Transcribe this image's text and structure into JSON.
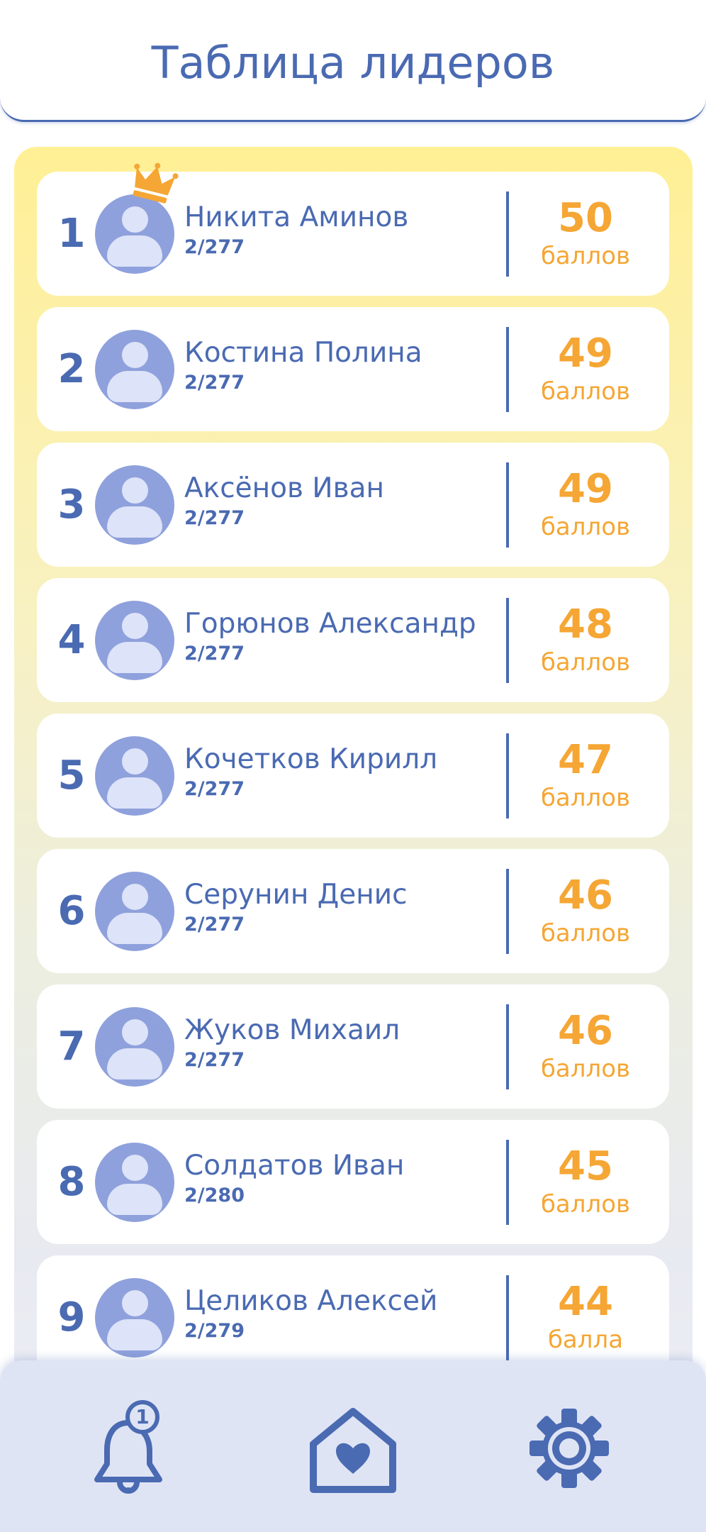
{
  "header": {
    "title": "Таблица лидеров"
  },
  "leaders": [
    {
      "rank": "1",
      "name": "Никита Аминов",
      "sub": "2/277",
      "score": "50",
      "unit": "баллов"
    },
    {
      "rank": "2",
      "name": "Костина Полина",
      "sub": "2/277",
      "score": "49",
      "unit": "баллов"
    },
    {
      "rank": "3",
      "name": "Аксёнов Иван",
      "sub": "2/277",
      "score": "49",
      "unit": "баллов"
    },
    {
      "rank": "4",
      "name": "Горюнов Александр",
      "sub": "2/277",
      "score": "48",
      "unit": "баллов"
    },
    {
      "rank": "5",
      "name": "Кочетков Кирилл",
      "sub": "2/277",
      "score": "47",
      "unit": "баллов"
    },
    {
      "rank": "6",
      "name": "Серунин Денис",
      "sub": "2/277",
      "score": "46",
      "unit": "баллов"
    },
    {
      "rank": "7",
      "name": "Жуков Михаил",
      "sub": "2/277",
      "score": "46",
      "unit": "баллов"
    },
    {
      "rank": "8",
      "name": "Солдатов Иван",
      "sub": "2/280",
      "score": "45",
      "unit": "баллов"
    },
    {
      "rank": "9",
      "name": "Целиков Алексей",
      "sub": "2/279",
      "score": "44",
      "unit": "балла"
    }
  ],
  "bottom_nav": {
    "notifications": {
      "icon": "bell-icon",
      "badge": "1"
    },
    "home": {
      "icon": "home-heart-icon"
    },
    "settings": {
      "icon": "gear-icon"
    }
  },
  "colors": {
    "primary": "#4a6ab2",
    "accent": "#f5a634",
    "avatar": "#8fa1dc",
    "nav_background": "#dfe4f5",
    "board_top": "#fff095",
    "board_bottom": "#e8eaf1"
  }
}
